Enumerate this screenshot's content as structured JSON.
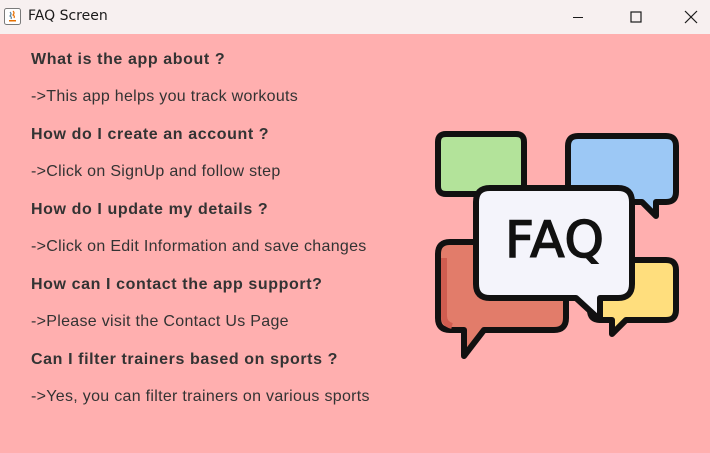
{
  "window": {
    "title": "FAQ Screen",
    "icons": {
      "app": "java-app-icon",
      "minimize": "minimize-icon",
      "maximize": "maximize-icon",
      "close": "close-icon"
    }
  },
  "colors": {
    "background": "#ffafaf",
    "text": "#333333",
    "titlebar": "#f7f0f0",
    "bubble_green": "#b3e39a",
    "bubble_blue": "#9cc8f5",
    "bubble_yellow": "#ffde7d",
    "bubble_red": "#e27c6a",
    "bubble_white": "#f4f4fb"
  },
  "faq": [
    {
      "question": "What is the app about ?",
      "answer": "->This app helps you track workouts"
    },
    {
      "question": "How do I create an account ?",
      "answer": "->Click on SignUp and follow step"
    },
    {
      "question": "How do I update my details ?",
      "answer": "->Click on Edit Information and save changes"
    },
    {
      "question": "How can I contact the app support?",
      "answer": "->Please visit the Contact Us Page"
    },
    {
      "question": "Can I filter trainers based on sports ?",
      "answer": "->Yes, you can filter trainers on various sports"
    }
  ],
  "illustration": {
    "label": "FAQ",
    "icon": "faq-speech-bubbles-icon"
  }
}
